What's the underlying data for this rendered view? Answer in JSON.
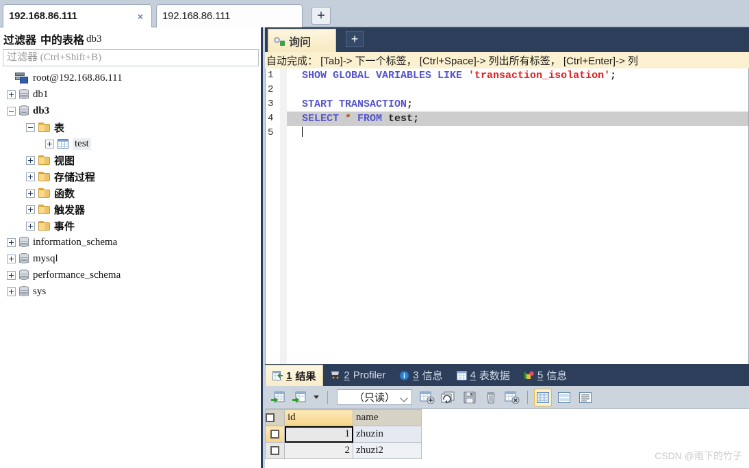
{
  "connection_tabs": {
    "tabs": [
      {
        "label": "192.168.86.111",
        "active": true,
        "close": "×"
      },
      {
        "label": "192.168.86.111",
        "active": false
      }
    ],
    "add_label": "+"
  },
  "sidebar": {
    "filter_header_prefix": "过滤器",
    "filter_header_middle": "中的表格",
    "filter_header_db": "db3",
    "filter_placeholder": "过滤器 (Ctrl+Shift+B)",
    "filter_value": "",
    "tree": [
      {
        "label": "root@192.168.86.111",
        "icon": "server-icon",
        "indent": 0,
        "expander": "none",
        "bold": false,
        "cjk": false
      },
      {
        "label": "db1",
        "icon": "database-icon",
        "indent": 1,
        "expander": "plus",
        "bold": false,
        "cjk": false
      },
      {
        "label": "db3",
        "icon": "database-icon",
        "indent": 1,
        "expander": "minus",
        "bold": true,
        "cjk": false
      },
      {
        "label": "表",
        "icon": "folder-icon",
        "indent": 2,
        "expander": "minus",
        "bold": false,
        "cjk": true
      },
      {
        "label": "test",
        "icon": "table-icon",
        "indent": 3,
        "expander": "plus",
        "bold": false,
        "cjk": false,
        "selected": true
      },
      {
        "label": "视图",
        "icon": "folder-icon",
        "indent": 2,
        "expander": "plus",
        "bold": false,
        "cjk": true
      },
      {
        "label": "存储过程",
        "icon": "folder-icon",
        "indent": 2,
        "expander": "plus",
        "bold": false,
        "cjk": true
      },
      {
        "label": "函数",
        "icon": "folder-icon",
        "indent": 2,
        "expander": "plus",
        "bold": false,
        "cjk": true
      },
      {
        "label": "触发器",
        "icon": "folder-icon",
        "indent": 2,
        "expander": "plus",
        "bold": false,
        "cjk": true
      },
      {
        "label": "事件",
        "icon": "folder-icon",
        "indent": 2,
        "expander": "plus",
        "bold": false,
        "cjk": true
      },
      {
        "label": "information_schema",
        "icon": "database-icon",
        "indent": 1,
        "expander": "plus",
        "bold": false,
        "cjk": false
      },
      {
        "label": "mysql",
        "icon": "database-icon",
        "indent": 1,
        "expander": "plus",
        "bold": false,
        "cjk": false
      },
      {
        "label": "performance_schema",
        "icon": "database-icon",
        "indent": 1,
        "expander": "plus",
        "bold": false,
        "cjk": false
      },
      {
        "label": "sys",
        "icon": "database-icon",
        "indent": 1,
        "expander": "plus",
        "bold": false,
        "cjk": false
      }
    ]
  },
  "query": {
    "tab_label": "询问",
    "add_label": "+",
    "hint": "自动完成： [Tab]-> 下一个标签， [Ctrl+Space]-> 列出所有标签， [Ctrl+Enter]-> 列",
    "line_numbers": [
      "1",
      "2",
      "3",
      "4",
      "5"
    ],
    "lines": [
      {
        "n": "1",
        "tokens": [
          {
            "t": "SHOW GLOBAL VARIABLES LIKE ",
            "c": "kw"
          },
          {
            "t": "'transaction_isolation'",
            "c": "str"
          },
          {
            "t": ";",
            "c": "pl"
          }
        ]
      },
      {
        "n": "2",
        "tokens": []
      },
      {
        "n": "3",
        "tokens": [
          {
            "t": "START TRANSACTION",
            "c": "kw"
          },
          {
            "t": ";",
            "c": "pl"
          }
        ]
      },
      {
        "n": "4",
        "selected": true,
        "tokens": [
          {
            "t": "SELECT ",
            "c": "kw"
          },
          {
            "t": "*",
            "c": "op"
          },
          {
            "t": " FROM ",
            "c": "kw"
          },
          {
            "t": "test",
            "c": "pl"
          },
          {
            "t": ";",
            "c": "pl"
          }
        ]
      },
      {
        "n": "5",
        "caret": true,
        "tokens": []
      }
    ]
  },
  "results": {
    "tabs": [
      {
        "num": "1",
        "label": "结果",
        "icon": "result-grid-icon",
        "active": true
      },
      {
        "num": "2",
        "label": "Profiler",
        "icon": "profiler-icon",
        "active": false
      },
      {
        "num": "3",
        "label": "信息",
        "icon": "info-icon",
        "active": false
      },
      {
        "num": "4",
        "label": "表数据",
        "icon": "table-data-icon",
        "active": false
      },
      {
        "num": "5",
        "label": "信息",
        "icon": "status-icon",
        "active": false
      }
    ],
    "toolbar": {
      "mode_value": "（只读）",
      "buttons": [
        {
          "name": "import-wizard-icon"
        },
        {
          "name": "export-wizard-icon"
        },
        {
          "name": "dropdown-caret-icon"
        },
        {
          "name": "add-record-icon"
        },
        {
          "name": "refresh-record-icon"
        },
        {
          "name": "apply-changes-icon"
        },
        {
          "name": "delete-record-icon"
        },
        {
          "name": "discard-changes-icon"
        },
        {
          "name": "grid-view-icon"
        },
        {
          "name": "form-view-icon"
        },
        {
          "name": "text-view-icon"
        }
      ]
    },
    "grid": {
      "columns": [
        "id",
        "name"
      ],
      "active_column": "id",
      "rows": [
        {
          "cells": [
            "1",
            "zhuzin"
          ],
          "current": true
        },
        {
          "cells": [
            "2",
            "zhuzi2"
          ],
          "current": false
        }
      ]
    }
  },
  "watermark": "CSDN @雨下的竹子"
}
